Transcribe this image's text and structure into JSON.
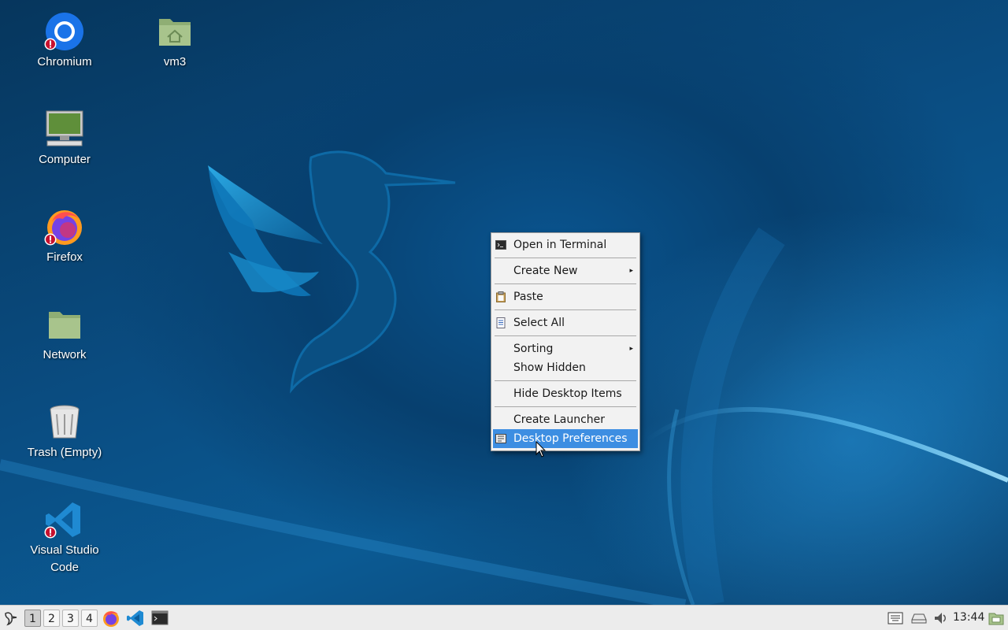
{
  "desktop": {
    "icons": [
      {
        "label": "Chromium",
        "icon": "chromium-icon",
        "badge": "warning-badge"
      },
      {
        "label": "vm3",
        "icon": "home-folder-icon"
      },
      {
        "label": "Computer",
        "icon": "computer-icon"
      },
      {
        "label": "Firefox",
        "icon": "firefox-icon",
        "badge": "warning-badge"
      },
      {
        "label": "Network",
        "icon": "network-folder-icon"
      },
      {
        "label": "Trash (Empty)",
        "icon": "trash-icon"
      },
      {
        "label_line1": "Visual Studio",
        "label_line2": "Code",
        "icon": "vscode-icon",
        "badge": "warning-badge"
      }
    ]
  },
  "context_menu": {
    "items": [
      {
        "label": "Open in Terminal",
        "icon": "terminal-icon"
      },
      {
        "label": "Create New",
        "submenu": true
      },
      {
        "label": "Paste",
        "icon": "clipboard-icon"
      },
      {
        "label": "Select All",
        "icon": "select-all-icon"
      },
      {
        "label": "Sorting",
        "submenu": true
      },
      {
        "label": "Show Hidden"
      },
      {
        "label": "Hide Desktop Items"
      },
      {
        "label": "Create Launcher"
      },
      {
        "label": "Desktop Preferences",
        "icon": "preferences-icon",
        "highlighted": true
      }
    ],
    "submenu_arrow": "▸"
  },
  "taskbar": {
    "menu_icon": "start-menu-icon",
    "workspaces": [
      "1",
      "2",
      "3",
      "4"
    ],
    "active_workspace": "1",
    "launchers": [
      "firefox-icon",
      "vscode-icon",
      "terminal-icon"
    ],
    "tray": [
      "keyboard-layout-icon",
      "drive-icon",
      "volume-icon"
    ],
    "clock": "13:44",
    "show_desktop_icon": "show-desktop-icon"
  },
  "colors": {
    "menu_highlight": "#3d8ee2",
    "desktop_bg": "#0a4d82",
    "taskbar_bg": "#ececec"
  }
}
